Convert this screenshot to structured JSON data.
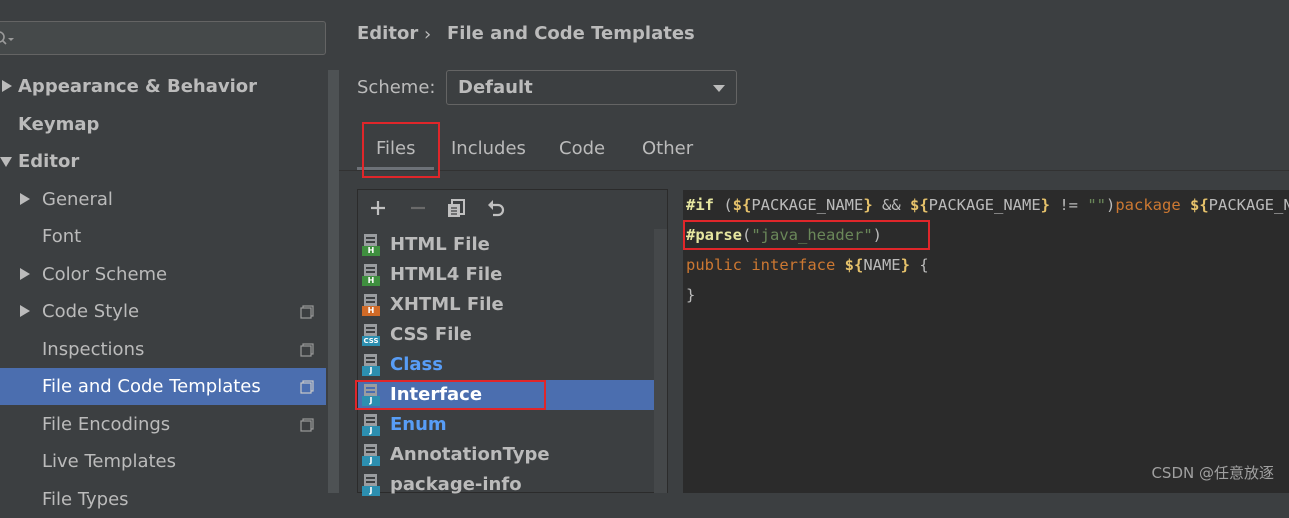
{
  "sidebar": {
    "search": {
      "placeholder": "",
      "icon": "search-icon"
    },
    "items": [
      {
        "label": "Appearance & Behavior"
      },
      {
        "label": "Keymap"
      },
      {
        "label": "Editor"
      },
      {
        "label": "General"
      },
      {
        "label": "Font"
      },
      {
        "label": "Color Scheme"
      },
      {
        "label": "Code Style"
      },
      {
        "label": "Inspections"
      },
      {
        "label": "File and Code Templates"
      },
      {
        "label": "File Encodings"
      },
      {
        "label": "Live Templates"
      },
      {
        "label": "File Types"
      }
    ]
  },
  "breadcrumb": {
    "parent": "Editor",
    "separator": "›",
    "current": "File and Code Templates"
  },
  "scheme": {
    "label": "Scheme:",
    "value": "Default"
  },
  "tabs": [
    {
      "label": "Files"
    },
    {
      "label": "Includes"
    },
    {
      "label": "Code"
    },
    {
      "label": "Other"
    }
  ],
  "files": [
    {
      "label": "HTML File",
      "badge": "H",
      "badge_color": "#3f8f3f"
    },
    {
      "label": "HTML4 File",
      "badge": "H",
      "badge_color": "#3f8f3f"
    },
    {
      "label": "XHTML File",
      "badge": "H",
      "badge_color": "#d06a27"
    },
    {
      "label": "CSS File",
      "badge": "CSS",
      "badge_color": "#2c8fb0"
    },
    {
      "label": "Class",
      "badge": "J",
      "badge_color": "#2c8fb0"
    },
    {
      "label": "Interface",
      "badge": "J",
      "badge_color": "#2c8fb0"
    },
    {
      "label": "Enum",
      "badge": "J",
      "badge_color": "#2c8fb0"
    },
    {
      "label": "AnnotationType",
      "badge": "J",
      "badge_color": "#2c8fb0"
    },
    {
      "label": "package-info",
      "badge": "J",
      "badge_color": "#2c8fb0"
    }
  ],
  "code": {
    "line1": [
      {
        "text": "#if",
        "color": "#e6e6a0",
        "bold": true
      },
      {
        "text": " (",
        "color": "#bbbbbb"
      },
      {
        "text": "${",
        "color": "#e6c26b",
        "bold": true
      },
      {
        "text": "PACKAGE_NAME",
        "color": "#bbbbbb"
      },
      {
        "text": "}",
        "color": "#e6c26b",
        "bold": true
      },
      {
        "text": " && ",
        "color": "#bbbbbb"
      },
      {
        "text": "${",
        "color": "#e6c26b",
        "bold": true
      },
      {
        "text": "PACKAGE_NAME",
        "color": "#bbbbbb"
      },
      {
        "text": "}",
        "color": "#e6c26b",
        "bold": true
      },
      {
        "text": " != ",
        "color": "#bbbbbb"
      },
      {
        "text": "\"\"",
        "color": "#6a8759"
      },
      {
        "text": ")",
        "color": "#bbbbbb"
      },
      {
        "text": "package ",
        "color": "#cc7832"
      },
      {
        "text": "${",
        "color": "#e6c26b",
        "bold": true
      },
      {
        "text": "PACKAGE_NAME",
        "color": "#bbbbbb"
      }
    ],
    "line2": [
      {
        "text": "#parse",
        "color": "#e6e6a0",
        "bold": true
      },
      {
        "text": "(",
        "color": "#bbbbbb"
      },
      {
        "text": "\"java_header\"",
        "color": "#6a8759"
      },
      {
        "text": ")",
        "color": "#bbbbbb"
      }
    ],
    "line3": [
      {
        "text": "public interface ",
        "color": "#cc7832"
      },
      {
        "text": "${",
        "color": "#e6c26b",
        "bold": true
      },
      {
        "text": "NAME",
        "color": "#bbbbbb"
      },
      {
        "text": "}",
        "color": "#e6c26b",
        "bold": true
      },
      {
        "text": " {",
        "color": "#bbbbbb"
      }
    ],
    "line4": [
      {
        "text": "}",
        "color": "#bbbbbb"
      }
    ]
  },
  "watermark": "CSDN @任意放逐",
  "colors": {
    "selection": "#4b6eaf",
    "highlight_box": "#e0262a",
    "background": "#3c3f41",
    "editor_bg": "#2b2b2b"
  }
}
